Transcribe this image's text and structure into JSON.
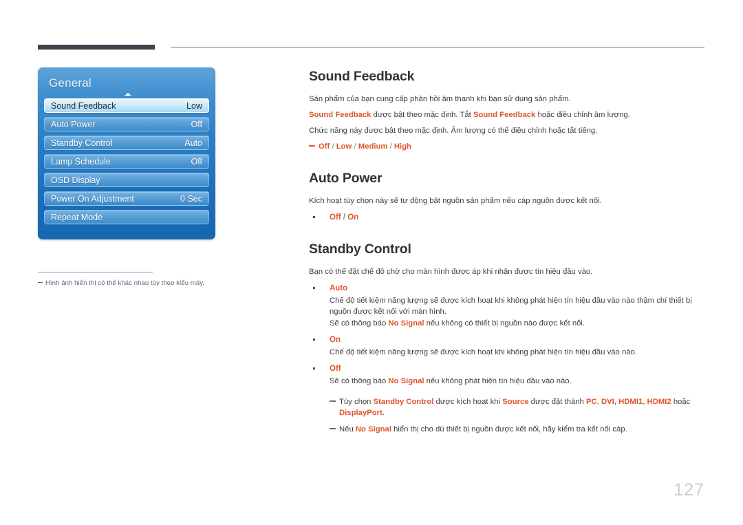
{
  "page": {
    "number": "127"
  },
  "osd": {
    "title": "General",
    "arrow_icon": "caret-up-icon",
    "rows": [
      {
        "label": "Sound Feedback",
        "value": "Low",
        "selected": true
      },
      {
        "label": "Auto Power",
        "value": "Off",
        "selected": false
      },
      {
        "label": "Standby Control",
        "value": "Auto",
        "selected": false
      },
      {
        "label": "Lamp Schedule",
        "value": "Off",
        "selected": false
      },
      {
        "label": "OSD Display",
        "value": "",
        "selected": false
      },
      {
        "label": "Power On Adjustment",
        "value": "0 Sec",
        "selected": false
      },
      {
        "label": "Repeat Mode",
        "value": "",
        "selected": false
      }
    ],
    "note": "Hình ảnh hiển thị có thể khác nhau tùy theo kiểu máy."
  },
  "sections": {
    "sound_feedback": {
      "title": "Sound Feedback",
      "line1": "Sản phẩm của bạn cung cấp phản hồi âm thanh khi bạn sử dụng sản phẩm.",
      "line2_a": "Sound Feedback",
      "line2_b": " được bật theo mặc định. Tắt ",
      "line2_c": "Sound Feedback",
      "line2_d": " hoặc điều chỉnh âm lượng.",
      "line3": "Chức năng này được bật theo mặc định. Âm lượng có thể điều chỉnh hoặc tắt tiếng.",
      "options": [
        "Off",
        "Low",
        "Medium",
        "High"
      ]
    },
    "auto_power": {
      "title": "Auto Power",
      "line1": "Kích hoạt tùy chọn này sẽ tự động bật nguồn sản phẩm nếu cáp nguồn được kết nối.",
      "options": [
        "Off",
        "On"
      ]
    },
    "standby_control": {
      "title": "Standby Control",
      "line1": "Bạn có thể đặt chế độ chờ cho màn hình được áp khi nhận được tín hiệu đầu vào.",
      "items": [
        {
          "head": "Auto",
          "body1": "Chế độ tiết kiệm năng lượng sẽ được kích hoạt khi không phát hiện tín hiệu đầu vào nào thậm chí thiết bị nguồn được kết nối với màn hình.",
          "body2_a": "Sẽ có thông báo ",
          "body2_kw": "No Signal",
          "body2_b": " nếu không có thiết bị nguồn nào được kết nối."
        },
        {
          "head": "On",
          "body1": "Chế độ tiết kiệm năng lượng sẽ được kích hoạt khi không phát hiện tín hiệu đầu vào nào.",
          "body2_a": "",
          "body2_kw": "",
          "body2_b": ""
        },
        {
          "head": "Off",
          "body1": "",
          "body2_a": "Sẽ có thông báo ",
          "body2_kw": "No Signal",
          "body2_b": " nếu không phát hiện tín hiệu đầu vào nào."
        }
      ],
      "notes": {
        "note1_a": "Tùy chọn ",
        "note1_kw1": "Standby Control",
        "note1_b": " được kích hoạt khi ",
        "note1_kw2": "Source",
        "note1_c": " được đặt thành ",
        "note1_kw3": "PC",
        "note1_d": ", ",
        "note1_kw4": "DVI",
        "note1_e": ", ",
        "note1_kw5": "HDMI1",
        "note1_f": ", ",
        "note1_kw6": "HDMI2",
        "note1_g": " hoặc ",
        "note1_kw7": "DisplayPort",
        "note1_h": ".",
        "note2_a": "Nếu ",
        "note2_kw": "No Signal",
        "note2_b": " hiển thị cho dù thiết bị nguồn được kết nối, hãy kiểm tra kết nối cáp."
      }
    }
  }
}
